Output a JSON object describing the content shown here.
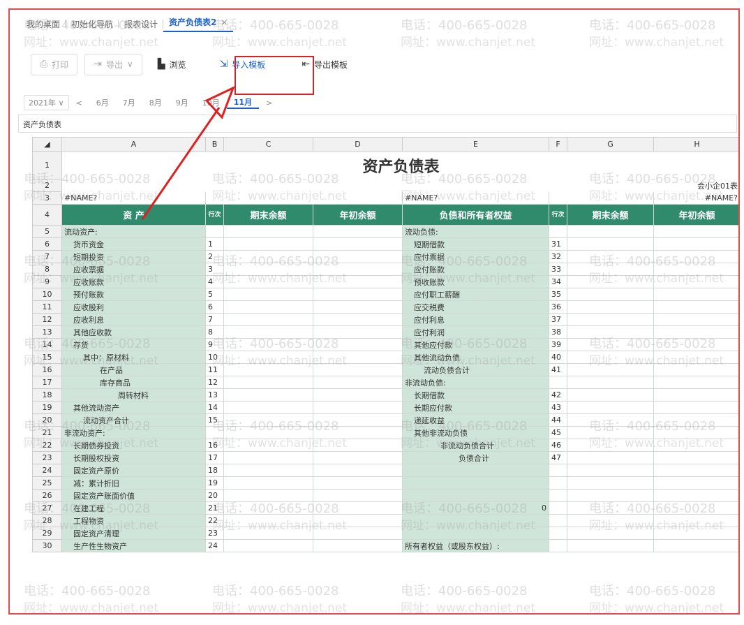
{
  "tabs": [
    {
      "label": "我的桌面"
    },
    {
      "label": "初始化导航"
    },
    {
      "label": "报表设计"
    },
    {
      "label": "资产负债表2",
      "close": "×"
    }
  ],
  "toolbar": {
    "print": "打印",
    "export": "导出",
    "export_caret": "∨",
    "browse": "浏览",
    "import_template": "导入模板",
    "export_template": "导出模板"
  },
  "periods": {
    "year": "2021年",
    "year_caret": "∨",
    "prev": "<",
    "months": [
      "6月",
      "7月",
      "8月",
      "9月",
      "10月",
      "11月"
    ],
    "next": ">"
  },
  "sheet_name": "资产负债表",
  "columns": [
    "A",
    "B",
    "C",
    "D",
    "E",
    "F",
    "G",
    "H"
  ],
  "report": {
    "title": "资产负债表",
    "code": "会小企01表",
    "name_err_left": "#NAME?",
    "name_err_mid": "#NAME?",
    "name_err_right": "#NAME?",
    "headers": {
      "assets": "资 产",
      "line_no": "行次",
      "end_balance": "期末余额",
      "begin_balance": "年初余额",
      "liabilities": "负债和所有者权益",
      "line_no2": "行次",
      "end_balance2": "期末余额",
      "begin_balance2": "年初余额"
    },
    "rows": [
      {
        "n": "5",
        "a": "流动资产:",
        "ai": 0,
        "b": "",
        "e": "流动负债:",
        "ei": 0,
        "f": ""
      },
      {
        "n": "6",
        "a": "货币资金",
        "ai": 1,
        "b": "1",
        "e": "短期借款",
        "ei": 1,
        "f": "31"
      },
      {
        "n": "7",
        "a": "短期投资",
        "ai": 1,
        "b": "2",
        "e": "应付票据",
        "ei": 1,
        "f": "32"
      },
      {
        "n": "8",
        "a": "应收票据",
        "ai": 1,
        "b": "3",
        "e": "应付账款",
        "ei": 1,
        "f": "33"
      },
      {
        "n": "9",
        "a": "应收账款",
        "ai": 1,
        "b": "4",
        "e": "预收账款",
        "ei": 1,
        "f": "34"
      },
      {
        "n": "10",
        "a": "预付账款",
        "ai": 1,
        "b": "5",
        "e": "应付职工薪酬",
        "ei": 1,
        "f": "35"
      },
      {
        "n": "11",
        "a": "应收股利",
        "ai": 1,
        "b": "6",
        "e": "应交税费",
        "ei": 1,
        "f": "36"
      },
      {
        "n": "12",
        "a": "应收利息",
        "ai": 1,
        "b": "7",
        "e": "应付利息",
        "ei": 1,
        "f": "37"
      },
      {
        "n": "13",
        "a": "其他应收款",
        "ai": 1,
        "b": "8",
        "e": "应付利润",
        "ei": 1,
        "f": "38"
      },
      {
        "n": "14",
        "a": "存货",
        "ai": 1,
        "b": "9",
        "e": "其他应付款",
        "ei": 1,
        "f": "39"
      },
      {
        "n": "15",
        "a": "其中：原材料",
        "ai": 2,
        "b": "10",
        "e": "其他流动负债",
        "ei": 1,
        "f": "40"
      },
      {
        "n": "16",
        "a": "在产品",
        "ai": 3,
        "b": "11",
        "e": "流动负债合计",
        "ei": 2,
        "f": "41"
      },
      {
        "n": "17",
        "a": "库存商品",
        "ai": 3,
        "b": "12",
        "e": "非流动负债:",
        "ei": 0,
        "f": ""
      },
      {
        "n": "18",
        "a": "周转材料",
        "ai": 4,
        "b": "13",
        "e": "长期借款",
        "ei": 1,
        "f": "42"
      },
      {
        "n": "19",
        "a": "其他流动资产",
        "ai": 1,
        "b": "14",
        "e": "长期应付款",
        "ei": 1,
        "f": "43"
      },
      {
        "n": "20",
        "a": "流动资产合计",
        "ai": 2,
        "b": "15",
        "e": "递延收益",
        "ei": 1,
        "f": "44"
      },
      {
        "n": "21",
        "a": "非流动资产:",
        "ai": 0,
        "b": "",
        "e": "其他非流动负债",
        "ei": 1,
        "f": "45"
      },
      {
        "n": "22",
        "a": "长期债券投资",
        "ai": 1,
        "b": "16",
        "e": "非流动负债合计",
        "ei": 3,
        "f": "46"
      },
      {
        "n": "23",
        "a": "长期股权投资",
        "ai": 1,
        "b": "17",
        "e": "负债合计",
        "ei": 4,
        "f": "47"
      },
      {
        "n": "24",
        "a": "固定资产原价",
        "ai": 1,
        "b": "18",
        "e": "",
        "ei": 0,
        "f": ""
      },
      {
        "n": "25",
        "a": "减：累计折旧",
        "ai": 1,
        "b": "19",
        "e": "",
        "ei": 0,
        "f": ""
      },
      {
        "n": "26",
        "a": "固定资产账面价值",
        "ai": 1,
        "b": "20",
        "e": "",
        "ei": 0,
        "f": ""
      },
      {
        "n": "27",
        "a": "在建工程",
        "ai": 1,
        "b": "21",
        "e": "0",
        "ei": -1,
        "f": ""
      },
      {
        "n": "28",
        "a": "工程物资",
        "ai": 1,
        "b": "22",
        "e": "",
        "ei": 0,
        "f": ""
      },
      {
        "n": "29",
        "a": "固定资产清理",
        "ai": 1,
        "b": "23",
        "e": "",
        "ei": 0,
        "f": ""
      },
      {
        "n": "30",
        "a": "生产性生物资产",
        "ai": 1,
        "b": "24",
        "e": "所有者权益（或股东权益）:",
        "ei": 0,
        "f": ""
      }
    ]
  },
  "watermark": {
    "phone": "电话：400-665-0028",
    "site": "网址：www.chanjet.net"
  }
}
